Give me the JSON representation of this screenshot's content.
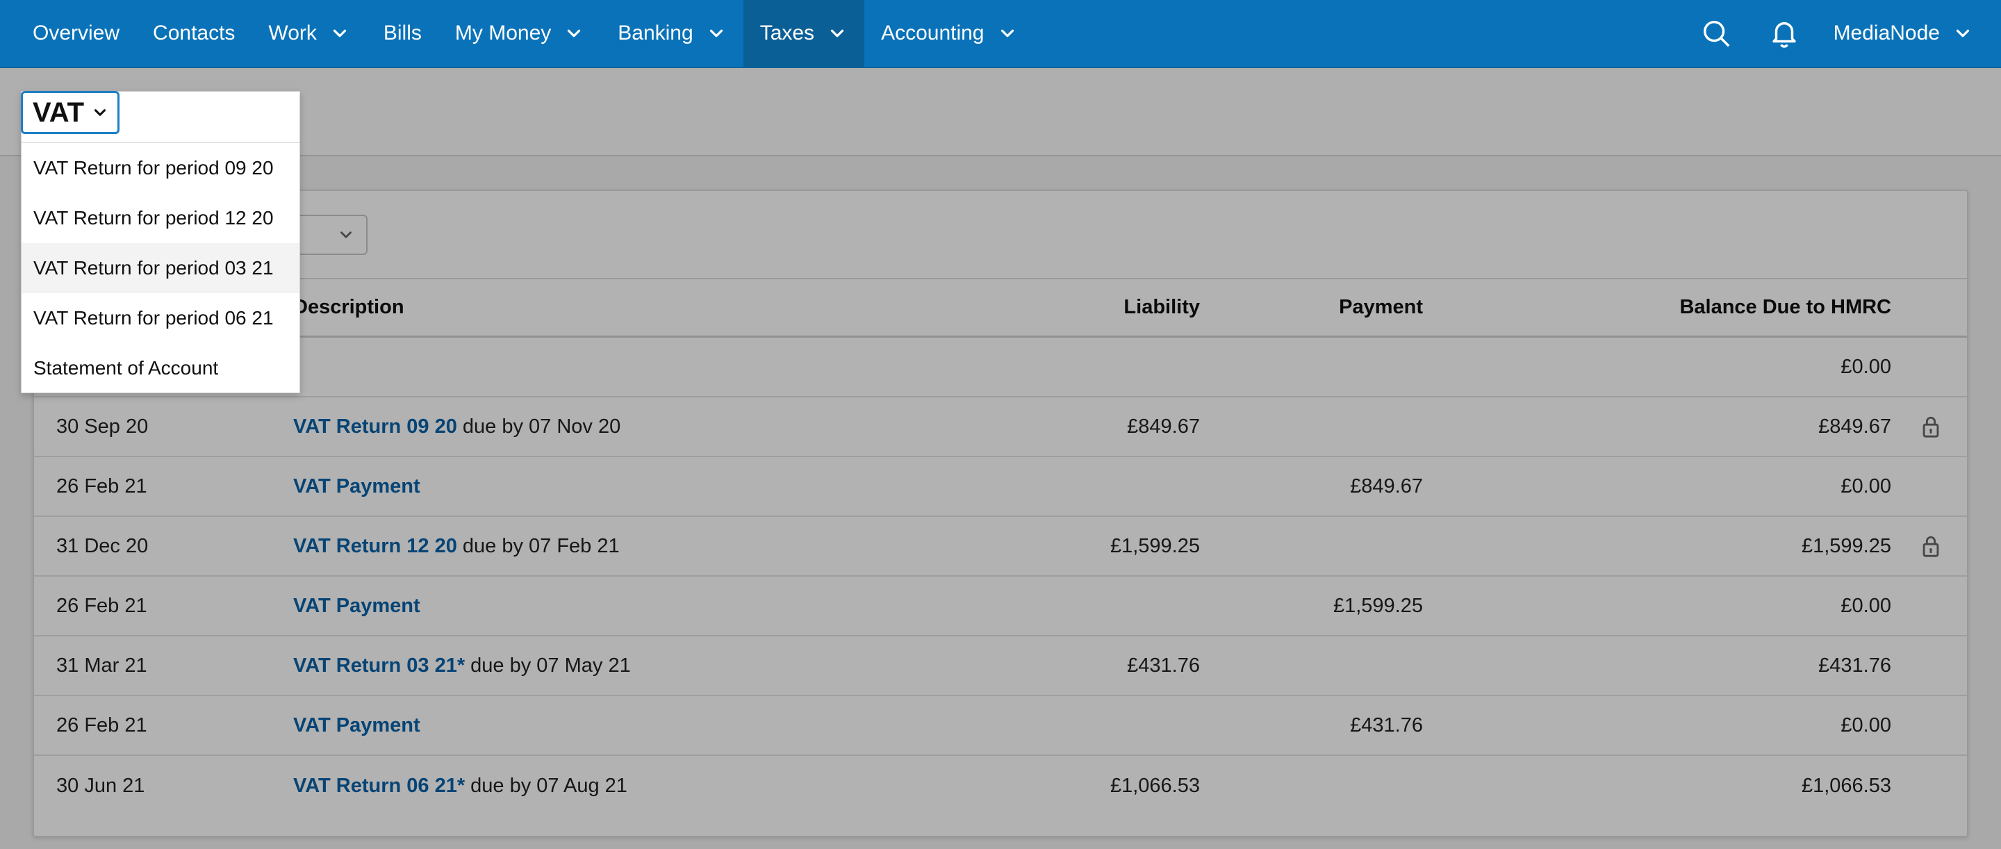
{
  "nav": {
    "items": [
      {
        "label": "Overview",
        "has_caret": false,
        "active": false
      },
      {
        "label": "Contacts",
        "has_caret": false,
        "active": false
      },
      {
        "label": "Work",
        "has_caret": true,
        "active": false
      },
      {
        "label": "Bills",
        "has_caret": false,
        "active": false
      },
      {
        "label": "My Money",
        "has_caret": true,
        "active": false
      },
      {
        "label": "Banking",
        "has_caret": true,
        "active": false
      },
      {
        "label": "Taxes",
        "has_caret": true,
        "active": true
      },
      {
        "label": "Accounting",
        "has_caret": true,
        "active": false
      }
    ],
    "account_label": "MediaNode",
    "search_icon": "search-icon",
    "notifications_icon": "bell-icon"
  },
  "tax_selector": {
    "value": "VAT",
    "options": [
      "VAT Return for period 09 20",
      "VAT Return for period 12 20",
      "VAT Return for period 03 21",
      "VAT Return for period 06 21",
      "Statement of Account"
    ],
    "hovered_index": 2
  },
  "table": {
    "headers": {
      "date": "",
      "description": "Description",
      "liability": "Liability",
      "payment": "Payment",
      "balance": "Balance Due to HMRC"
    },
    "rows": [
      {
        "date": "",
        "link": "",
        "desc_rest": "",
        "liability": "",
        "payment": "",
        "balance": "£0.00",
        "locked": false
      },
      {
        "date": "30 Sep 20",
        "link": "VAT Return 09 20",
        "desc_rest": " due by 07 Nov 20",
        "liability": "£849.67",
        "payment": "",
        "balance": "£849.67",
        "locked": true
      },
      {
        "date": "26 Feb 21",
        "link": "VAT Payment",
        "desc_rest": "",
        "liability": "",
        "payment": "£849.67",
        "balance": "£0.00",
        "locked": false
      },
      {
        "date": "31 Dec 20",
        "link": "VAT Return 12 20",
        "desc_rest": " due by 07 Feb 21",
        "liability": "£1,599.25",
        "payment": "",
        "balance": "£1,599.25",
        "locked": true
      },
      {
        "date": "26 Feb 21",
        "link": "VAT Payment",
        "desc_rest": "",
        "liability": "",
        "payment": "£1,599.25",
        "balance": "£0.00",
        "locked": false
      },
      {
        "date": "31 Mar 21",
        "link": "VAT Return 03 21*",
        "desc_rest": " due by 07 May 21",
        "liability": "£431.76",
        "payment": "",
        "balance": "£431.76",
        "locked": false
      },
      {
        "date": "26 Feb 21",
        "link": "VAT Payment",
        "desc_rest": "",
        "liability": "",
        "payment": "£431.76",
        "balance": "£0.00",
        "locked": false
      },
      {
        "date": "30 Jun 21",
        "link": "VAT Return 06 21*",
        "desc_rest": " due by 07 Aug 21",
        "liability": "£1,066.53",
        "payment": "",
        "balance": "£1,066.53",
        "locked": false
      }
    ]
  },
  "colors": {
    "nav_bg": "#0a72b8",
    "link": "#0a62a8",
    "select_border": "#1f7fc4"
  }
}
